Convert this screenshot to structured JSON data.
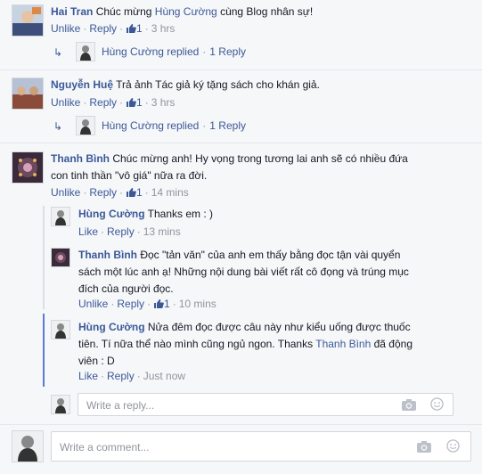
{
  "comments": [
    {
      "author": "Hai Tran",
      "text": "Chúc mừng",
      "mention": "Hùng Cường",
      "text_after": "cùng Blog nhân sự!",
      "actions": {
        "like": "Unlike",
        "reply": "Reply",
        "likes": "1",
        "time": "3 hrs"
      },
      "replied": {
        "by": "Hùng Cường replied",
        "count": "1 Reply"
      }
    },
    {
      "author": "Nguyễn Huệ",
      "text": "Trả ảnh Tác giả ký tặng sách cho khán giả.",
      "actions": {
        "like": "Unlike",
        "reply": "Reply",
        "likes": "1",
        "time": "3 hrs"
      },
      "replied": {
        "by": "Hùng Cường replied",
        "count": "1 Reply"
      }
    },
    {
      "author": "Thanh Bình",
      "text_line1": "Chúc mừng anh! Hy vọng trong tương lai anh sẽ có nhiều đứa",
      "text_line2": "con tinh thần \"vô giá\" nữa ra đời.",
      "actions": {
        "like": "Unlike",
        "reply": "Reply",
        "likes": "1",
        "time": "14 mins"
      },
      "replies": [
        {
          "author": "Hùng Cường",
          "text": "Thanks em : )",
          "actions": {
            "like": "Like",
            "reply": "Reply",
            "time": "13 mins"
          }
        },
        {
          "author": "Thanh Bình",
          "text_line1": "Đọc \"tản văn\" của anh em thấy bằng đọc tận vài quyển",
          "text_line2": "sách một lúc anh ạ! Những nội dung bài viết rất cô đọng và trúng mục",
          "text_line3": "đích của người đọc.",
          "actions": {
            "like": "Unlike",
            "reply": "Reply",
            "likes": "1",
            "time": "10 mins"
          }
        },
        {
          "author": "Hùng Cường",
          "text_line1": "Nửa đêm đọc được câu này như kiểu uống được thuốc",
          "text_line2a": "tiên. Tí nữa thể nào mình cũng ngủ ngon. Thanks",
          "mention": "Thanh Bình",
          "text_line2b": "đã động",
          "text_line3": "viên : D",
          "actions": {
            "like": "Like",
            "reply": "Reply",
            "time": "Just now"
          }
        }
      ]
    }
  ],
  "reply_input": {
    "placeholder": "Write a reply..."
  },
  "comment_input": {
    "placeholder": "Write a comment..."
  },
  "icons": {
    "camera": "camera-icon",
    "emoji": "emoji-icon",
    "like": "thumbs-up-icon",
    "reply_arrow": "reply-arrow-icon"
  },
  "colors": {
    "link": "#3b5998",
    "meta": "#90949c",
    "active_thread": "#5b7bd5"
  }
}
